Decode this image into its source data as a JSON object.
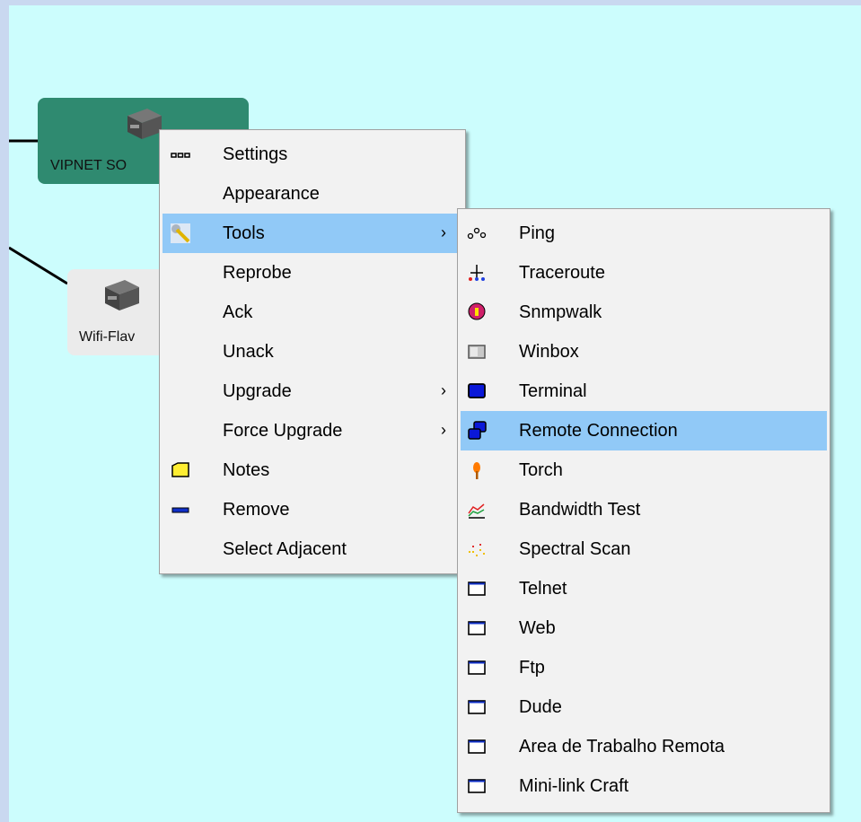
{
  "canvas": {
    "background": "#ccfdfd"
  },
  "nodes": [
    {
      "label": "VIPNET SO",
      "color": "#2f8a70"
    },
    {
      "label": "Wifi-Flav",
      "color": "#ebebeb"
    }
  ],
  "context_menu": {
    "items": [
      {
        "label": "Settings",
        "icon": "settings-icon",
        "submenu": false
      },
      {
        "label": "Appearance",
        "icon": "",
        "submenu": false
      },
      {
        "label": "Tools",
        "icon": "wrench-icon",
        "submenu": true,
        "highlighted": true
      },
      {
        "label": "Reprobe",
        "icon": "",
        "submenu": false
      },
      {
        "label": "Ack",
        "icon": "",
        "submenu": false
      },
      {
        "label": "Unack",
        "icon": "",
        "submenu": false
      },
      {
        "label": "Upgrade",
        "icon": "",
        "submenu": true
      },
      {
        "label": "Force Upgrade",
        "icon": "",
        "submenu": true
      },
      {
        "label": "Notes",
        "icon": "notes-icon",
        "submenu": false
      },
      {
        "label": "Remove",
        "icon": "remove-icon",
        "submenu": false
      },
      {
        "label": "Select Adjacent",
        "icon": "",
        "submenu": false
      }
    ],
    "submenu_arrow": "›"
  },
  "tools_submenu": {
    "items": [
      {
        "label": "Ping",
        "icon": "ping-icon"
      },
      {
        "label": "Traceroute",
        "icon": "traceroute-icon"
      },
      {
        "label": "Snmpwalk",
        "icon": "snmpwalk-icon"
      },
      {
        "label": "Winbox",
        "icon": "winbox-icon"
      },
      {
        "label": "Terminal",
        "icon": "terminal-icon"
      },
      {
        "label": "Remote Connection",
        "icon": "remote-connection-icon",
        "highlighted": true
      },
      {
        "label": "Torch",
        "icon": "torch-icon"
      },
      {
        "label": "Bandwidth Test",
        "icon": "bandwidth-test-icon"
      },
      {
        "label": "Spectral Scan",
        "icon": "spectral-scan-icon"
      },
      {
        "label": "Telnet",
        "icon": "window-icon"
      },
      {
        "label": "Web",
        "icon": "window-icon"
      },
      {
        "label": "Ftp",
        "icon": "window-icon"
      },
      {
        "label": "Dude",
        "icon": "window-icon"
      },
      {
        "label": "Area de Trabalho Remota",
        "icon": "window-icon"
      },
      {
        "label": "Mini-link Craft",
        "icon": "window-icon"
      }
    ]
  },
  "highlight_color": "#91c9f7"
}
